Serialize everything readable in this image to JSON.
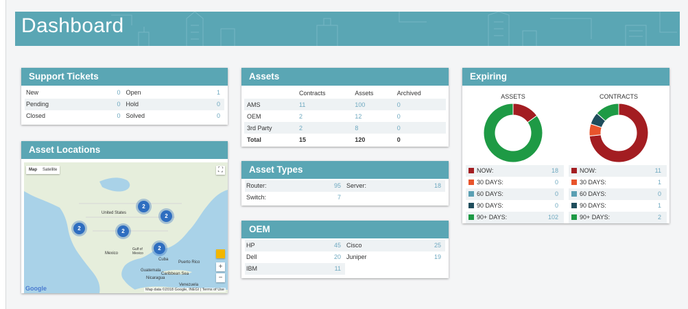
{
  "dashboard": {
    "title": "Dashboard"
  },
  "support_tickets": {
    "title": "Support Tickets",
    "rows": [
      {
        "a": {
          "label": "New",
          "value": "0"
        },
        "b": {
          "label": "Open",
          "value": "1"
        }
      },
      {
        "a": {
          "label": "Pending",
          "value": "0"
        },
        "b": {
          "label": "Hold",
          "value": "0"
        }
      },
      {
        "a": {
          "label": "Closed",
          "value": "0"
        },
        "b": {
          "label": "Solved",
          "value": "0"
        }
      }
    ]
  },
  "asset_locations": {
    "title": "Asset Locations",
    "tabs": {
      "map": "Map",
      "satellite": "Satellite"
    },
    "labels": {
      "us": "United States",
      "mexico": "Mexico",
      "cuba": "Cuba",
      "gulf": "Gulf of Mexico",
      "caribbean": "Caribbean Sea",
      "puerto_rico": "Puerto Rico",
      "guatemala": "Guatemala",
      "nicaragua": "Nicaragua",
      "venezuela": "Venezuela"
    },
    "clusters": [
      "2",
      "2",
      "2",
      "2",
      "2"
    ],
    "zoom_in": "+",
    "zoom_out": "−",
    "fullscreen": "⛶",
    "logo": "Google",
    "attribution": "Map data ©2018 Google, INEGI | Terms of Use"
  },
  "assets": {
    "title": "Assets",
    "headers": [
      "",
      "Contracts",
      "Assets",
      "Archived"
    ],
    "rows": [
      [
        "AMS",
        "11",
        "100",
        "0"
      ],
      [
        "OEM",
        "2",
        "12",
        "0"
      ],
      [
        "3rd Party",
        "2",
        "8",
        "0"
      ],
      [
        "Total",
        "15",
        "120",
        "0"
      ]
    ]
  },
  "asset_types": {
    "title": "Asset Types",
    "rows": [
      {
        "a": {
          "label": "Router:",
          "value": "95"
        },
        "b": {
          "label": "Server:",
          "value": "18"
        }
      },
      {
        "a": {
          "label": "Switch:",
          "value": "7"
        },
        "b": {
          "label": "",
          "value": ""
        }
      }
    ]
  },
  "oem": {
    "title": "OEM",
    "rows": [
      {
        "a": {
          "label": "HP",
          "value": "45"
        },
        "b": {
          "label": "Cisco",
          "value": "25"
        }
      },
      {
        "a": {
          "label": "Dell",
          "value": "20"
        },
        "b": {
          "label": "Juniper",
          "value": "19"
        }
      },
      {
        "a": {
          "label": "IBM",
          "value": "11"
        },
        "b": {
          "label": "",
          "value": ""
        }
      }
    ]
  },
  "expiring": {
    "title": "Expiring",
    "colors": {
      "now": "#a31d21",
      "d30": "#e8542c",
      "d60": "#5a9fb3",
      "d90": "#1f4d5c",
      "d90plus": "#1e9a45"
    },
    "assets": {
      "title": "ASSETS",
      "legend": [
        {
          "label": "NOW:",
          "value": "18"
        },
        {
          "label": "30 DAYS:",
          "value": "0"
        },
        {
          "label": "60 DAYS:",
          "value": "0"
        },
        {
          "label": "90 DAYS:",
          "value": "0"
        },
        {
          "label": "90+ DAYS:",
          "value": "102"
        }
      ],
      "values": [
        18,
        0,
        0,
        0,
        102
      ]
    },
    "contracts": {
      "title": "CONTRACTS",
      "legend": [
        {
          "label": "NOW:",
          "value": "11"
        },
        {
          "label": "30 DAYS:",
          "value": "1"
        },
        {
          "label": "60 DAYS:",
          "value": "0"
        },
        {
          "label": "90 DAYS:",
          "value": "1"
        },
        {
          "label": "90+ DAYS:",
          "value": "2"
        }
      ],
      "values": [
        11,
        1,
        0,
        1,
        2
      ]
    }
  }
}
